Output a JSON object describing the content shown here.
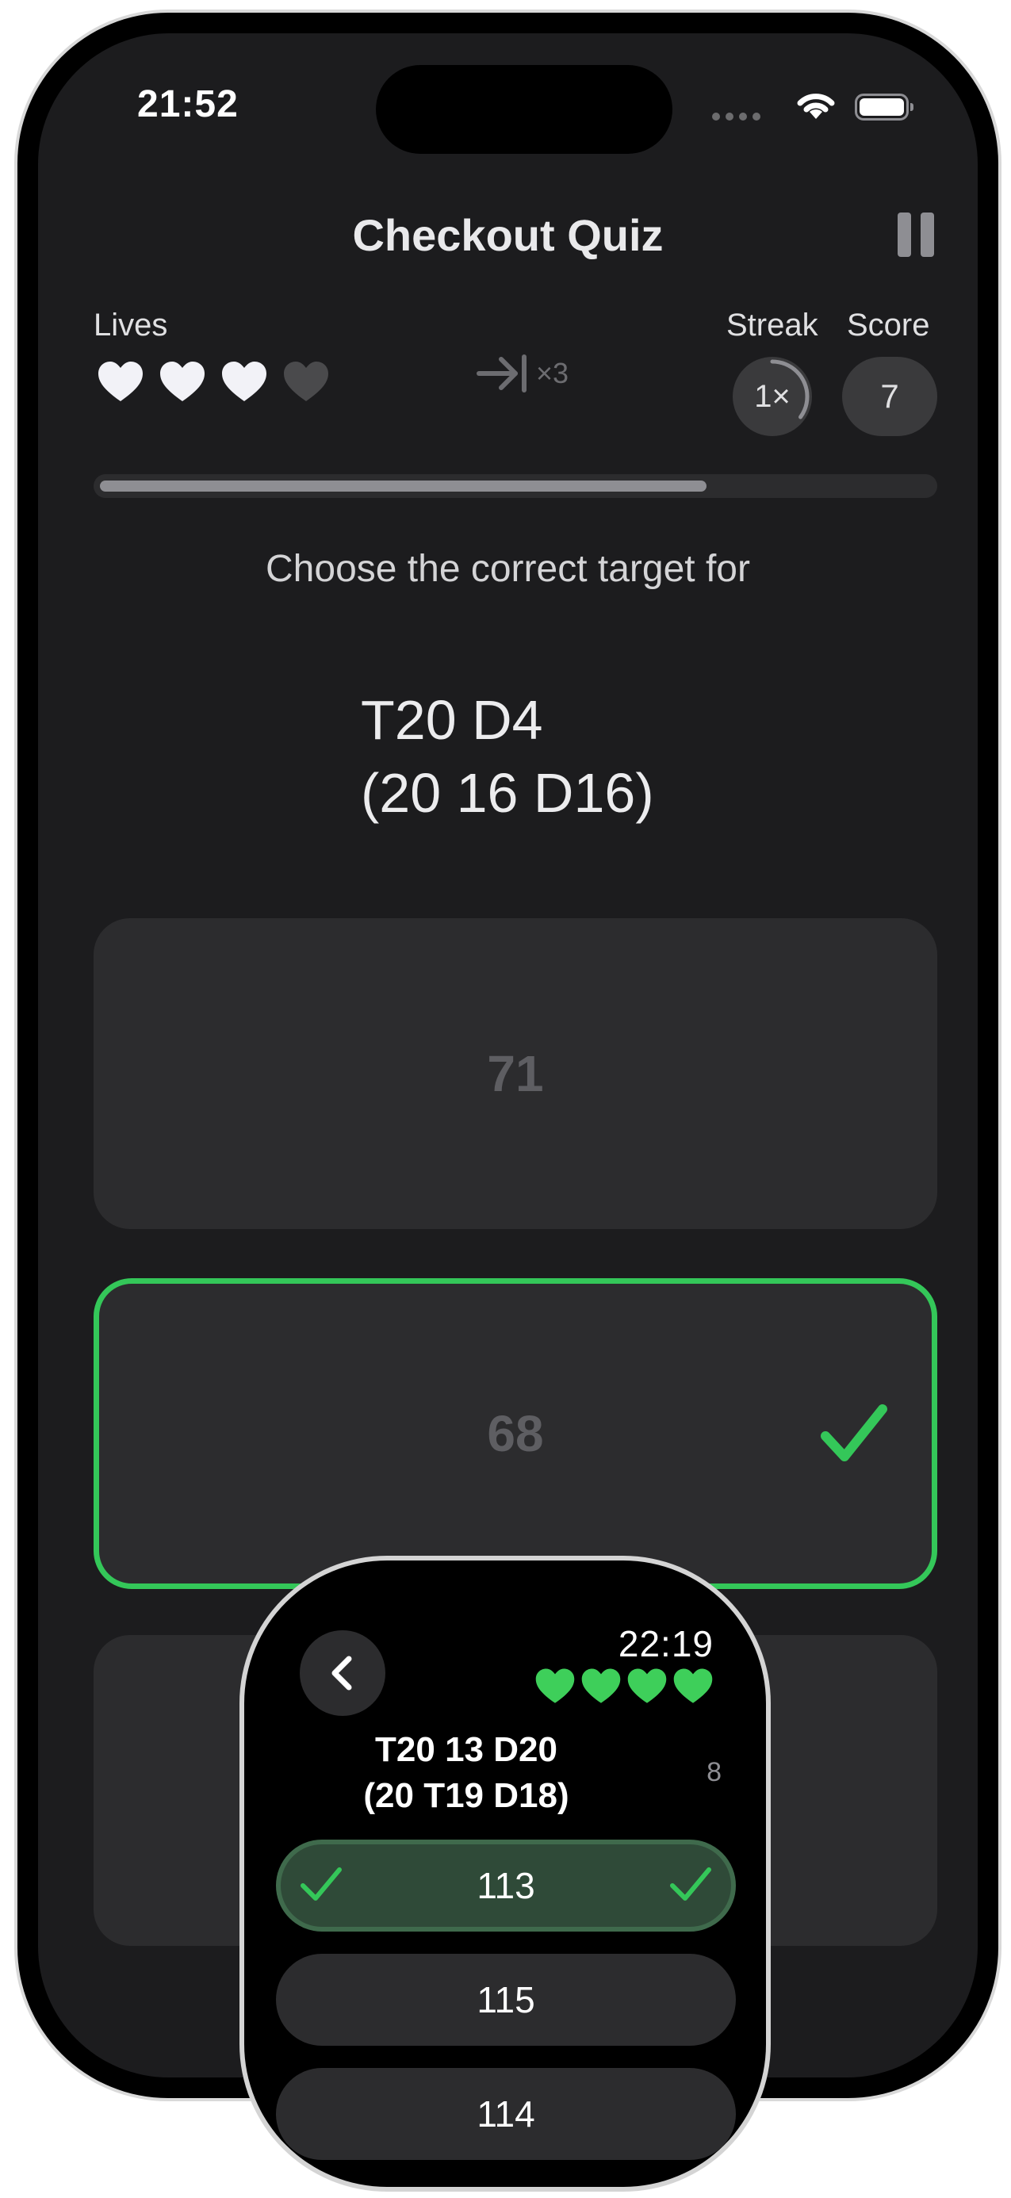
{
  "status_bar": {
    "time": "21:52"
  },
  "nav": {
    "title": "Checkout Quiz",
    "pause_icon": "pause-icon"
  },
  "stats": {
    "lives_label": "Lives",
    "lives_total": 4,
    "lives_remaining": 3,
    "skip_icon": "skip-forward-icon",
    "skip_count": "×3",
    "streak_label": "Streak",
    "streak_value": "1×",
    "streak_progress": 0.35,
    "score_label": "Score",
    "score_value": "7"
  },
  "progress": {
    "fraction": 0.73
  },
  "prompt": "Choose the correct target for",
  "question": {
    "line1": "T20 D4",
    "line2": "(20 16 D16)"
  },
  "answers": [
    {
      "label": "71",
      "state": "neutral"
    },
    {
      "label": "68",
      "state": "correct"
    },
    {
      "label": "",
      "state": "neutral"
    }
  ],
  "watch": {
    "time": "22:19",
    "lives": 4,
    "question_line1": "T20 13 D20",
    "question_line2": "(20 T19 D18)",
    "count": "8",
    "options": [
      {
        "label": "113",
        "state": "correct"
      },
      {
        "label": "115",
        "state": "neutral"
      },
      {
        "label": "114",
        "state": "neutral"
      }
    ]
  },
  "colors": {
    "background": "#1c1c1e",
    "card": "#2c2c2e",
    "accent_green": "#34c759",
    "watch_selected": "#2f4a38"
  }
}
